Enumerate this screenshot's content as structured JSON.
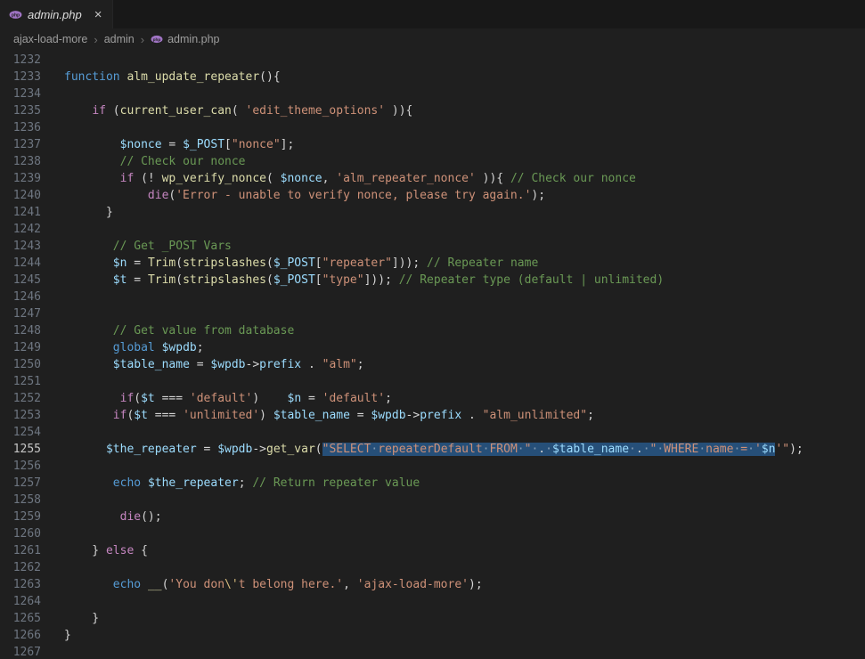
{
  "tab": {
    "label": "admin.php",
    "close_glyph": "×"
  },
  "breadcrumb": {
    "items": [
      "ajax-load-more",
      "admin",
      "admin.php"
    ],
    "separator": "›"
  },
  "colors": {
    "editor_bg": "#1f1f1f",
    "tabstrip_bg": "#181818",
    "selection": "#264f78",
    "php_icon": "#a074c4",
    "keyword": "#569cd6",
    "control": "#c586c0",
    "function": "#dcdcaa",
    "variable": "#9cdcfe",
    "string": "#ce9178",
    "comment": "#6a9955"
  },
  "editor": {
    "active_line": 1255,
    "lines": [
      {
        "n": 1232,
        "tokens": []
      },
      {
        "n": 1233,
        "tokens": [
          {
            "t": "function",
            "c": "kw"
          },
          {
            "t": " "
          },
          {
            "t": "alm_update_repeater",
            "c": "fn"
          },
          {
            "t": "(){"
          }
        ]
      },
      {
        "n": 1234,
        "tokens": []
      },
      {
        "n": 1235,
        "tokens": [
          {
            "t": "    "
          },
          {
            "t": "if",
            "c": "ctrl"
          },
          {
            "t": " ("
          },
          {
            "t": "current_user_can",
            "c": "fn"
          },
          {
            "t": "( "
          },
          {
            "t": "'edit_theme_options'",
            "c": "str"
          },
          {
            "t": " )){"
          }
        ]
      },
      {
        "n": 1236,
        "tokens": []
      },
      {
        "n": 1237,
        "tokens": [
          {
            "t": "        "
          },
          {
            "t": "$nonce",
            "c": "var"
          },
          {
            "t": " = "
          },
          {
            "t": "$_POST",
            "c": "var"
          },
          {
            "t": "["
          },
          {
            "t": "\"nonce\"",
            "c": "str"
          },
          {
            "t": "];"
          }
        ]
      },
      {
        "n": 1238,
        "tokens": [
          {
            "t": "        "
          },
          {
            "t": "// Check our nonce",
            "c": "com"
          }
        ]
      },
      {
        "n": 1239,
        "tokens": [
          {
            "t": "        "
          },
          {
            "t": "if",
            "c": "ctrl"
          },
          {
            "t": " (! "
          },
          {
            "t": "wp_verify_nonce",
            "c": "fn"
          },
          {
            "t": "( "
          },
          {
            "t": "$nonce",
            "c": "var"
          },
          {
            "t": ", "
          },
          {
            "t": "'alm_repeater_nonce'",
            "c": "str"
          },
          {
            "t": " )){ "
          },
          {
            "t": "// Check our nonce",
            "c": "com"
          }
        ]
      },
      {
        "n": 1240,
        "tokens": [
          {
            "t": "            "
          },
          {
            "t": "die",
            "c": "ctrl"
          },
          {
            "t": "("
          },
          {
            "t": "'Error - unable to verify nonce, please try again.'",
            "c": "str"
          },
          {
            "t": ");"
          }
        ]
      },
      {
        "n": 1241,
        "tokens": [
          {
            "t": "      }"
          }
        ]
      },
      {
        "n": 1242,
        "tokens": []
      },
      {
        "n": 1243,
        "tokens": [
          {
            "t": "       "
          },
          {
            "t": "// Get _POST Vars",
            "c": "com"
          }
        ]
      },
      {
        "n": 1244,
        "tokens": [
          {
            "t": "       "
          },
          {
            "t": "$n",
            "c": "var"
          },
          {
            "t": " = "
          },
          {
            "t": "Trim",
            "c": "fn"
          },
          {
            "t": "("
          },
          {
            "t": "stripslashes",
            "c": "fn"
          },
          {
            "t": "("
          },
          {
            "t": "$_POST",
            "c": "var"
          },
          {
            "t": "["
          },
          {
            "t": "\"repeater\"",
            "c": "str"
          },
          {
            "t": "])); "
          },
          {
            "t": "// Repeater name",
            "c": "com"
          }
        ]
      },
      {
        "n": 1245,
        "tokens": [
          {
            "t": "       "
          },
          {
            "t": "$t",
            "c": "var"
          },
          {
            "t": " = "
          },
          {
            "t": "Trim",
            "c": "fn"
          },
          {
            "t": "("
          },
          {
            "t": "stripslashes",
            "c": "fn"
          },
          {
            "t": "("
          },
          {
            "t": "$_POST",
            "c": "var"
          },
          {
            "t": "["
          },
          {
            "t": "\"type\"",
            "c": "str"
          },
          {
            "t": "])); "
          },
          {
            "t": "// Repeater type (default | unlimited)",
            "c": "com"
          }
        ]
      },
      {
        "n": 1246,
        "tokens": []
      },
      {
        "n": 1247,
        "tokens": []
      },
      {
        "n": 1248,
        "tokens": [
          {
            "t": "       "
          },
          {
            "t": "// Get value from database",
            "c": "com"
          }
        ]
      },
      {
        "n": 1249,
        "tokens": [
          {
            "t": "       "
          },
          {
            "t": "global",
            "c": "kw"
          },
          {
            "t": " "
          },
          {
            "t": "$wpdb",
            "c": "var"
          },
          {
            "t": ";"
          }
        ]
      },
      {
        "n": 1250,
        "tokens": [
          {
            "t": "       "
          },
          {
            "t": "$table_name",
            "c": "var"
          },
          {
            "t": " = "
          },
          {
            "t": "$wpdb",
            "c": "var"
          },
          {
            "t": "->"
          },
          {
            "t": "prefix",
            "c": "var"
          },
          {
            "t": " . "
          },
          {
            "t": "\"alm\"",
            "c": "str"
          },
          {
            "t": ";"
          }
        ]
      },
      {
        "n": 1251,
        "tokens": []
      },
      {
        "n": 1252,
        "tokens": [
          {
            "t": "        "
          },
          {
            "t": "if",
            "c": "ctrl"
          },
          {
            "t": "("
          },
          {
            "t": "$t",
            "c": "var"
          },
          {
            "t": " === "
          },
          {
            "t": "'default'",
            "c": "str"
          },
          {
            "t": ")    "
          },
          {
            "t": "$n",
            "c": "var"
          },
          {
            "t": " = "
          },
          {
            "t": "'default'",
            "c": "str"
          },
          {
            "t": ";"
          }
        ]
      },
      {
        "n": 1253,
        "tokens": [
          {
            "t": "       "
          },
          {
            "t": "if",
            "c": "ctrl"
          },
          {
            "t": "("
          },
          {
            "t": "$t",
            "c": "var"
          },
          {
            "t": " === "
          },
          {
            "t": "'unlimited'",
            "c": "str"
          },
          {
            "t": ") "
          },
          {
            "t": "$table_name",
            "c": "var"
          },
          {
            "t": " = "
          },
          {
            "t": "$wpdb",
            "c": "var"
          },
          {
            "t": "->"
          },
          {
            "t": "prefix",
            "c": "var"
          },
          {
            "t": " . "
          },
          {
            "t": "\"alm_unlimited\"",
            "c": "str"
          },
          {
            "t": ";"
          }
        ]
      },
      {
        "n": 1254,
        "tokens": []
      },
      {
        "n": 1255,
        "tokens": [
          {
            "t": "      "
          },
          {
            "t": "$the_repeater",
            "c": "var"
          },
          {
            "t": " = "
          },
          {
            "t": "$wpdb",
            "c": "var"
          },
          {
            "t": "->"
          },
          {
            "t": "get_var",
            "c": "fn"
          },
          {
            "t": "("
          },
          {
            "t": "\"SELECT repeaterDefault FROM \"",
            "c": "str",
            "s": true
          },
          {
            "t": " . ",
            "s": true
          },
          {
            "t": "$table_name",
            "c": "var",
            "s": true
          },
          {
            "t": " . ",
            "s": true
          },
          {
            "t": "\" WHERE name = '",
            "c": "str",
            "s": true
          },
          {
            "t": "$n",
            "c": "var",
            "s": true
          },
          {
            "t": "'\"",
            "c": "str"
          },
          {
            "t": ");"
          }
        ]
      },
      {
        "n": 1256,
        "tokens": []
      },
      {
        "n": 1257,
        "tokens": [
          {
            "t": "       "
          },
          {
            "t": "echo",
            "c": "kw"
          },
          {
            "t": " "
          },
          {
            "t": "$the_repeater",
            "c": "var"
          },
          {
            "t": "; "
          },
          {
            "t": "// Return repeater value",
            "c": "com"
          }
        ]
      },
      {
        "n": 1258,
        "tokens": []
      },
      {
        "n": 1259,
        "tokens": [
          {
            "t": "        "
          },
          {
            "t": "die",
            "c": "ctrl"
          },
          {
            "t": "();"
          }
        ]
      },
      {
        "n": 1260,
        "tokens": []
      },
      {
        "n": 1261,
        "tokens": [
          {
            "t": "    } "
          },
          {
            "t": "else",
            "c": "ctrl"
          },
          {
            "t": " {"
          }
        ]
      },
      {
        "n": 1262,
        "tokens": []
      },
      {
        "n": 1263,
        "tokens": [
          {
            "t": "       "
          },
          {
            "t": "echo",
            "c": "kw"
          },
          {
            "t": " "
          },
          {
            "t": "__",
            "c": "fn"
          },
          {
            "t": "("
          },
          {
            "t": "'You don",
            "c": "str"
          },
          {
            "t": "\\'",
            "c": "esc"
          },
          {
            "t": "t belong here.'",
            "c": "str"
          },
          {
            "t": ", "
          },
          {
            "t": "'ajax-load-more'",
            "c": "str"
          },
          {
            "t": ");"
          }
        ]
      },
      {
        "n": 1264,
        "tokens": []
      },
      {
        "n": 1265,
        "tokens": [
          {
            "t": "    }"
          }
        ]
      },
      {
        "n": 1266,
        "tokens": [
          {
            "t": "}"
          }
        ]
      },
      {
        "n": 1267,
        "tokens": []
      }
    ]
  }
}
